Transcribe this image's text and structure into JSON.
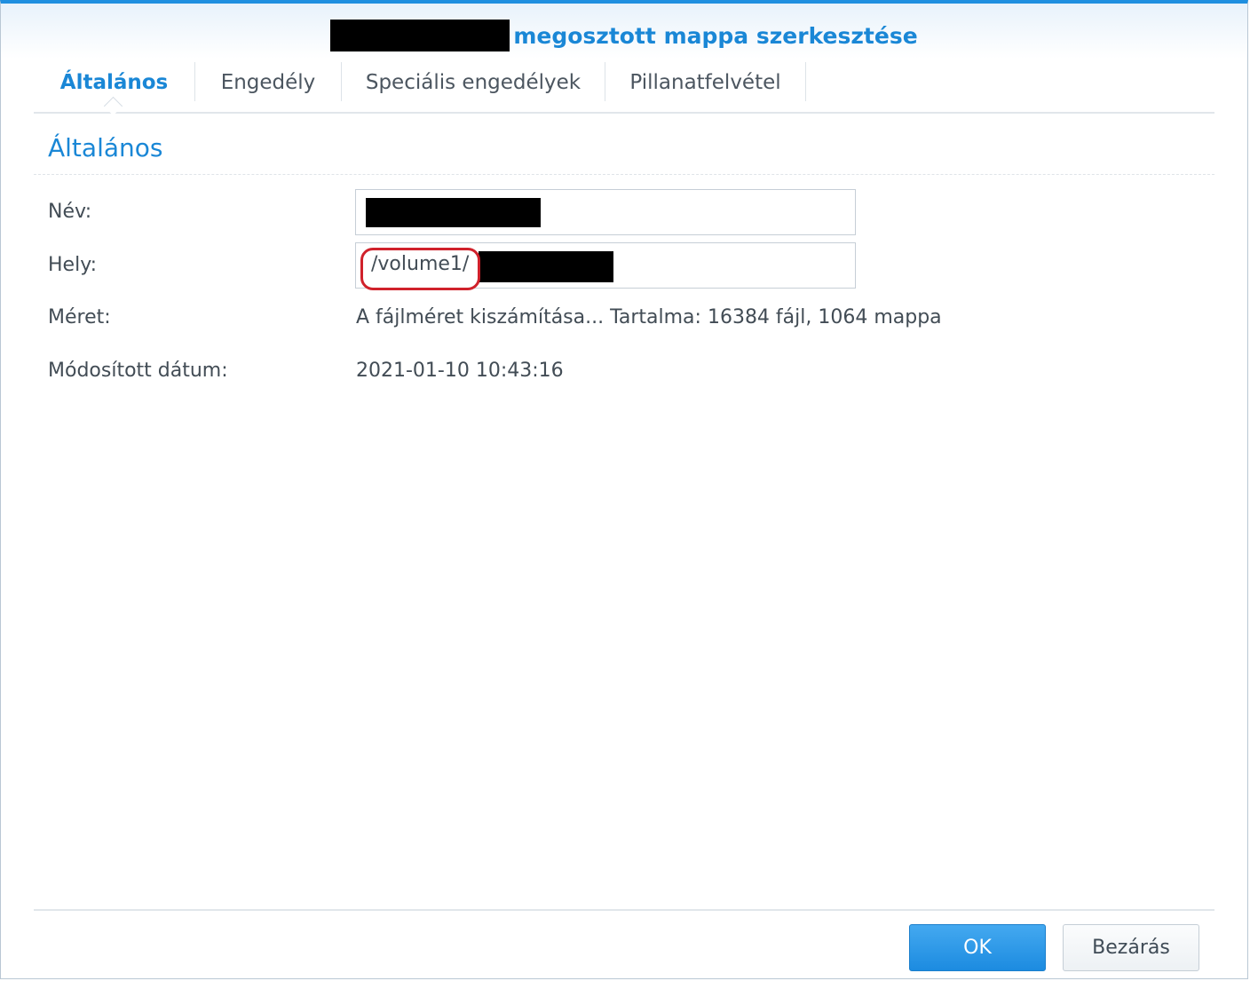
{
  "dialog": {
    "title": "megosztott mappa szerkesztése",
    "title_prefix_redacted": true,
    "accent_color": "#1a87d6"
  },
  "tabs": [
    {
      "label": "Általános",
      "active": true
    },
    {
      "label": "Engedély",
      "active": false
    },
    {
      "label": "Speciális engedélyek",
      "active": false
    },
    {
      "label": "Pillanatfelvétel",
      "active": false
    }
  ],
  "section": {
    "title": "Általános"
  },
  "form": {
    "name_label": "Név:",
    "name_value_redacted": true,
    "location_label": "Hely:",
    "location_prefix": "/volume1/",
    "location_suffix_redacted": true,
    "size_label": "Méret:",
    "size_value": "A fájlméret kiszámítása... Tartalma: 16384 fájl, 1064 mappa",
    "modified_label": "Módosított dátum:",
    "modified_value": "2021-01-10 10:43:16"
  },
  "annotation": {
    "ring_color": "#d0212b",
    "target": "location_prefix"
  },
  "buttons": {
    "ok": "OK",
    "close": "Bezárás"
  }
}
